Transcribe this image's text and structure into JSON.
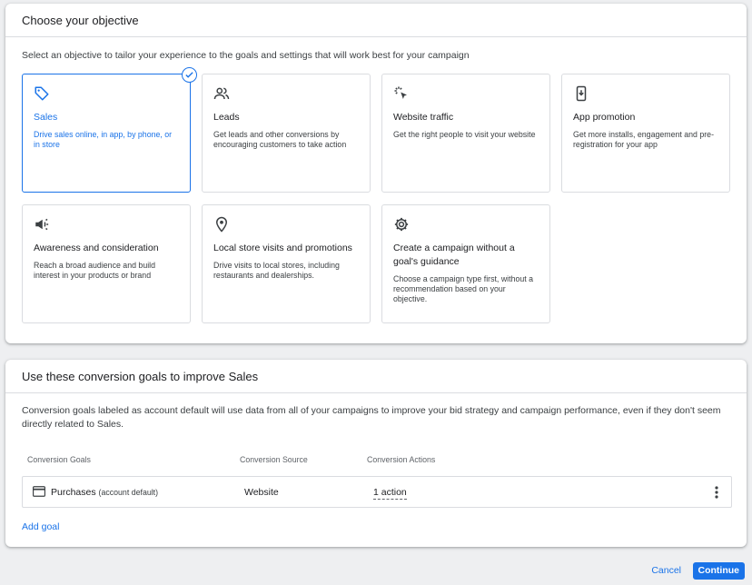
{
  "objective": {
    "title": "Choose your objective",
    "subtitle": "Select an objective to tailor your experience to the goals and settings that will work best for your campaign",
    "tiles": [
      {
        "icon": "tag-icon",
        "title": "Sales",
        "desc": "Drive sales online, in app, by phone, or in store",
        "selected": true
      },
      {
        "icon": "people-icon",
        "title": "Leads",
        "desc": "Get leads and other conversions by encouraging customers to take action"
      },
      {
        "icon": "cursor-click-icon",
        "title": "Website traffic",
        "desc": "Get the right people to visit your website"
      },
      {
        "icon": "phone-download-icon",
        "title": "App promotion",
        "desc": "Get more installs, engagement and pre-registration for your app"
      },
      {
        "icon": "megaphone-icon",
        "title": "Awareness and consideration",
        "desc": "Reach a broad audience and build interest in your products or brand"
      },
      {
        "icon": "location-pin-icon",
        "title": "Local store visits and promotions",
        "desc": "Drive visits to local stores, including restaurants and dealerships."
      },
      {
        "icon": "gear-icon",
        "title": "Create a campaign without a goal's guidance",
        "desc": "Choose a campaign type first, without a recommendation based on your objective."
      }
    ]
  },
  "conversion": {
    "title": "Use these conversion goals to improve Sales",
    "description": "Conversion goals labeled as account default will use data from all of your campaigns to improve your bid strategy and campaign performance, even if they don't seem directly related to Sales.",
    "columns": [
      "Conversion Goals",
      "Conversion Source",
      "Conversion Actions"
    ],
    "row": {
      "goal": "Purchases",
      "goal_note": "(account default)",
      "source": "Website",
      "actions": "1 action"
    },
    "add_goal": "Add goal"
  },
  "footer": {
    "cancel": "Cancel",
    "continue": "Continue"
  },
  "colors": {
    "accent": "#1a73e8",
    "border": "#dadce0",
    "background": "#eeeff1"
  }
}
